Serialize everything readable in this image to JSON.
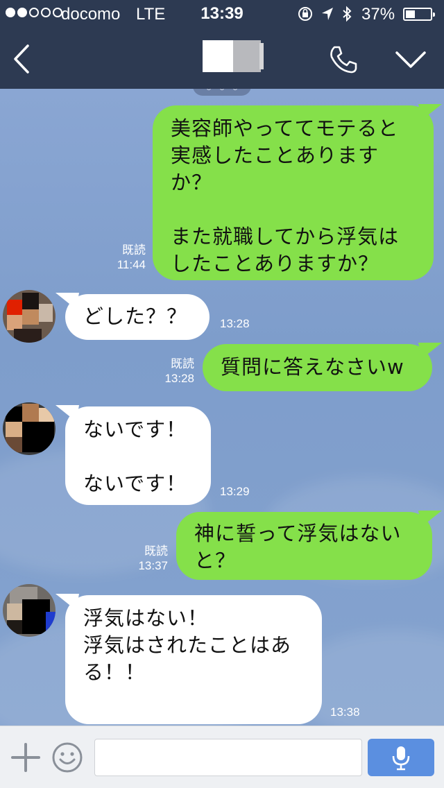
{
  "status_bar": {
    "carrier": "docomo",
    "network": "LTE",
    "time": "13:39",
    "battery_percent": "37%",
    "battery_level": 0.37,
    "signal_bars": 2,
    "icons": [
      "orientation-lock-icon",
      "location-arrow-icon",
      "bluetooth-icon"
    ]
  },
  "header": {
    "back_icon": "chevron-left-icon",
    "call_icon": "phone-icon",
    "menu_icon": "chevron-down-icon"
  },
  "messages": [
    {
      "direction": "out",
      "text": "美容師やっててモテると\n実感したことありますか？\n\nまた就職してから浮気は\nしたことありますか？",
      "read": "既読",
      "time": "11:44"
    },
    {
      "direction": "in",
      "text": "どした？？",
      "time": "13:28"
    },
    {
      "direction": "out",
      "text": "質問に答えなさいw",
      "read": "既読",
      "time": "13:28"
    },
    {
      "direction": "in",
      "text": "ないです！\n\nないです！",
      "time": "13:29"
    },
    {
      "direction": "out",
      "text": "神に誓って浮気はない\nと？",
      "read": "既読",
      "time": "13:37"
    },
    {
      "direction": "in",
      "text": "浮気はない！\n浮気はされたことはあ\nる！！\n",
      "time": "13:38"
    }
  ],
  "input_bar": {
    "plus_icon": "plus-icon",
    "emoji_icon": "emoji-icon",
    "mic_icon": "microphone-icon",
    "field_value": "",
    "accent": "#5b8fe0"
  },
  "colors": {
    "header_bg": "#2d3a52",
    "outgoing_bubble": "#85e04a",
    "incoming_bubble": "#ffffff",
    "chat_bg": "#7f9cc9"
  }
}
